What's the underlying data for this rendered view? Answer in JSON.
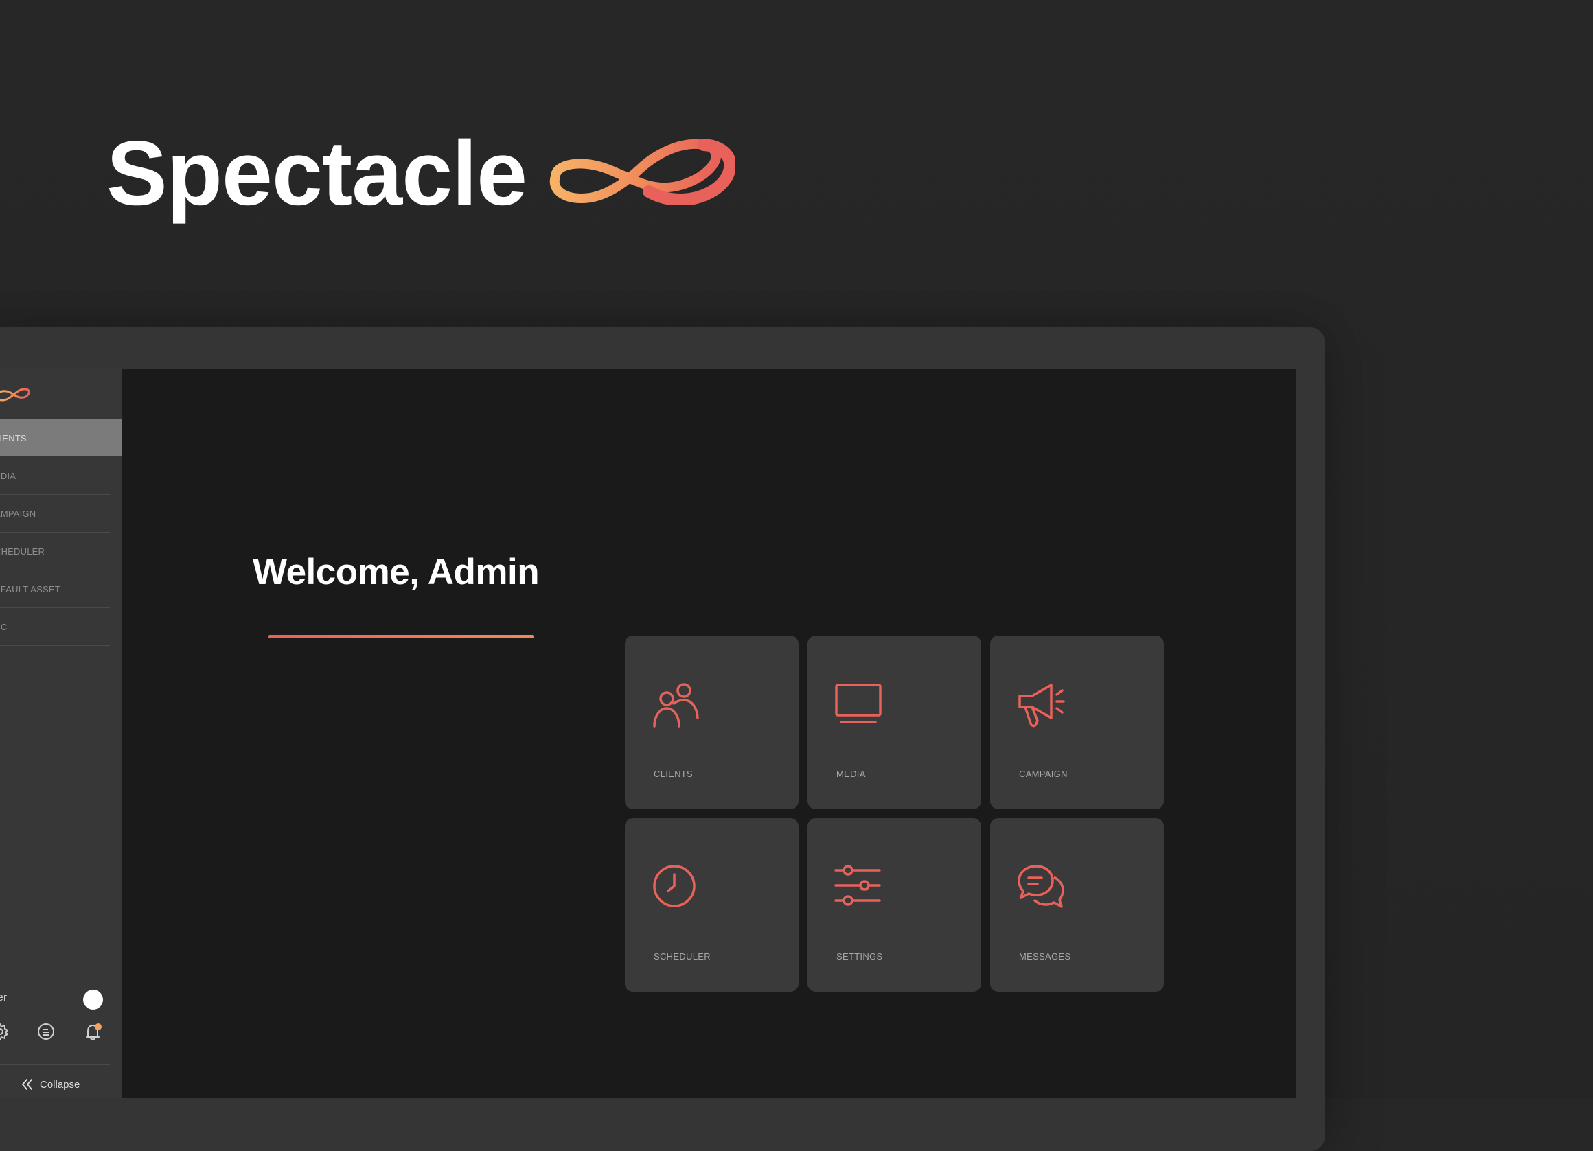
{
  "brand": {
    "name": "Spectacle",
    "logo_icon": "infinity-icon"
  },
  "colors": {
    "accent": "#e8615a",
    "accent_light": "#f4a261",
    "background": "#262626",
    "panel": "#1a1a1a",
    "tile": "#3a3a3a"
  },
  "sidebar": {
    "items": [
      {
        "label": "LIENTS",
        "active": true
      },
      {
        "label": "EDIA"
      },
      {
        "label": "AMPAIGN"
      },
      {
        "label": "CHEDULER"
      },
      {
        "label": "EFAULT ASSET"
      },
      {
        "label": "SC"
      }
    ],
    "user_label": "ser",
    "icons": [
      "gear-icon",
      "document-icon",
      "bell-icon"
    ],
    "collapse_label": "Collapse"
  },
  "main": {
    "welcome": "Welcome, Admin",
    "tiles": [
      {
        "label": "CLIENTS",
        "icon": "users-icon"
      },
      {
        "label": "MEDIA",
        "icon": "monitor-icon"
      },
      {
        "label": "CAMPAIGN",
        "icon": "megaphone-icon"
      },
      {
        "label": "SCHEDULER",
        "icon": "clock-icon"
      },
      {
        "label": "SETTINGS",
        "icon": "sliders-icon"
      },
      {
        "label": "MESSAGES",
        "icon": "chat-icon"
      }
    ]
  }
}
